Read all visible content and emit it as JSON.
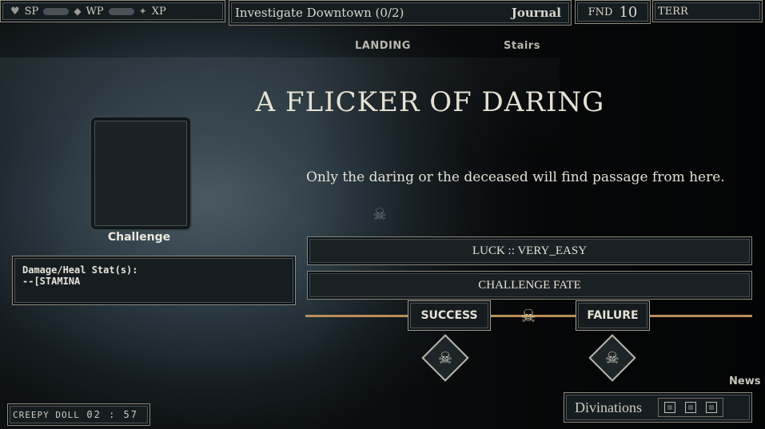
{
  "hud": {
    "sp_label": "SP",
    "wp_label": "WP",
    "xp_label": "XP",
    "quest": "Investigate Downtown (0/2)",
    "journal": "Journal",
    "fnd_label": "FND",
    "fnd_value": "10",
    "terr_label": "TERR"
  },
  "locations": [
    "LANDING",
    "Stairs"
  ],
  "event": {
    "title": "A FLICKER OF DARING",
    "description": "Only the daring or the deceased will find passage from here."
  },
  "card": {
    "label": "Challenge",
    "stats_title": "Damage/Heal Stat(s):",
    "stats_value": "--[STAMINA"
  },
  "actions": {
    "luck": "LUCK :: VERY_EASY",
    "challenge": "CHALLENGE FATE"
  },
  "outcomes": {
    "success": "SUCCESS",
    "failure": "FAILURE"
  },
  "footer": {
    "news": "News",
    "divinations": "Divinations",
    "doll_name": "CREEPY DOLL",
    "timer": "02 : 57"
  },
  "colors": {
    "accent": "#b98d5a",
    "panel": "#161d21",
    "border": "#8c8a80"
  },
  "icons": [
    "heart-icon",
    "sp-meter",
    "wp-meter",
    "xp-icon",
    "skull-icon",
    "skull-diamond-icon"
  ]
}
